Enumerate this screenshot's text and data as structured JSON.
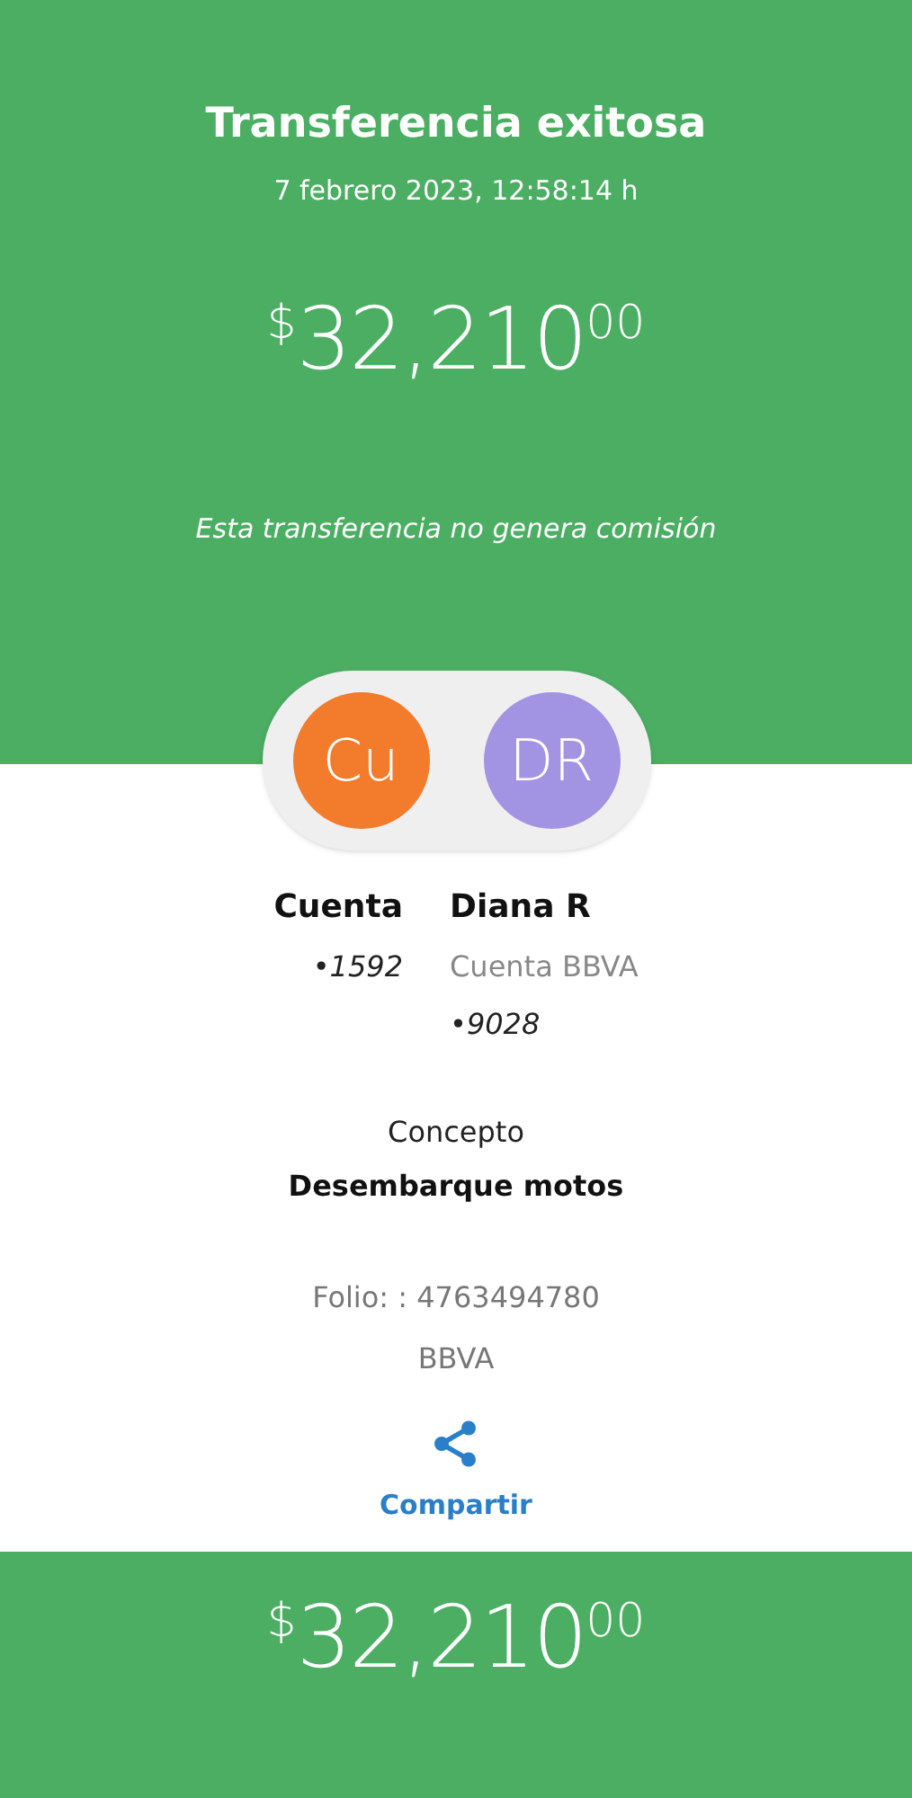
{
  "header": {
    "title": "Transferencia exitosa",
    "datetime": "7 febrero 2023, 12:58:14 h",
    "amount": {
      "currency": "$",
      "integer": "32,210",
      "cents": "00"
    },
    "note": "Esta transferencia no genera comisión"
  },
  "parties": [
    {
      "initials": "Cu",
      "color": "#f27b2c",
      "name": "Cuenta",
      "lines": [
        "•1592"
      ]
    },
    {
      "initials": "DR",
      "color": "#a393e3",
      "name": "Diana R",
      "lines": [
        "Cuenta BBVA",
        "•9028"
      ]
    }
  ],
  "concept": {
    "label": "Concepto",
    "value": "Desembarque motos"
  },
  "folio": "Folio: : 4763494780",
  "bank": "BBVA",
  "share": {
    "label": "Compartir"
  },
  "footer": {
    "amount": {
      "currency": "$",
      "integer": "32,210",
      "cents": "00"
    }
  }
}
